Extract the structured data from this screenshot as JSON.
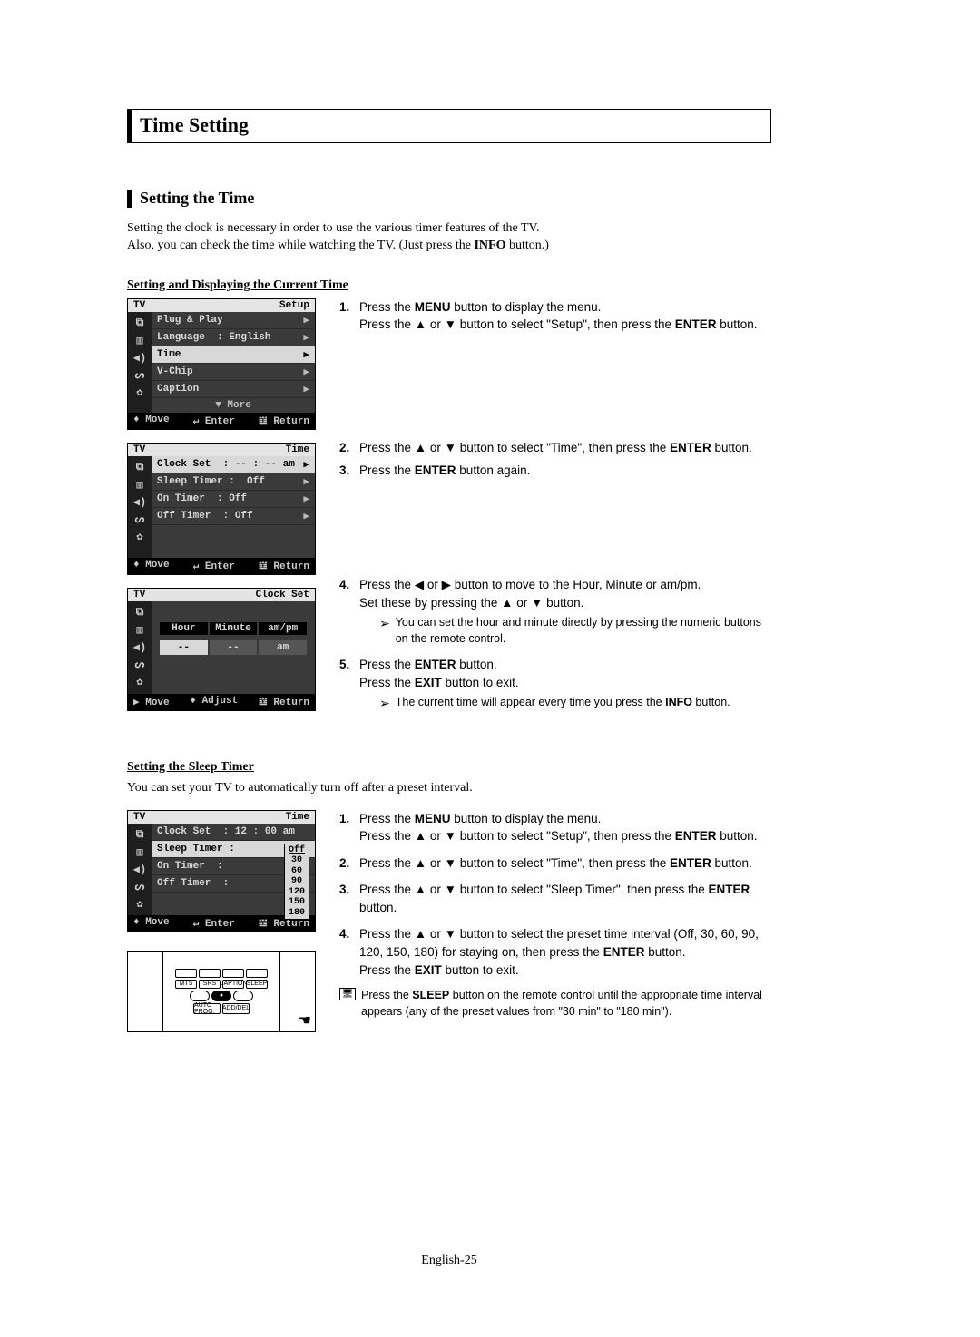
{
  "title": "Time Setting",
  "subtitle": "Setting the Time",
  "intro_line1": "Setting the clock is necessary in order to use the various timer features of the TV.",
  "intro_line2": "Also, you can check the time while watching the TV. (Just press the ",
  "intro_info": "INFO",
  "intro_line2b": " button.)",
  "sect1_label": "Setting and Displaying the Current Time",
  "osd": {
    "tv": "TV",
    "setup": "Setup",
    "time": "Time",
    "clockset": "Clock Set",
    "rows_setup": {
      "r1": "Plug & Play",
      "r2a": "Language",
      "r2b": ":  English",
      "r3": "Time",
      "r4": "V-Chip",
      "r5": "Caption",
      "more": "▼ More"
    },
    "rows_time": {
      "r1a": "Clock Set",
      "r1b": ": -- : -- am",
      "r2a": "Sleep Timer :",
      "r2b": "Off",
      "r3a": "On Timer",
      "r3b": ":  Off",
      "r4a": "Off Timer",
      "r4b": ":  Off"
    },
    "clock_cols": {
      "c1": "Hour",
      "c2": "Minute",
      "c3": "am/pm"
    },
    "clock_vals": {
      "v1": "--",
      "v2": "--",
      "v3": "am"
    },
    "foot": {
      "move_ud": "♦ Move",
      "move_r": "▶ Move",
      "enter": "↵ Enter",
      "adjust": "♦ Adjust",
      "ret": "𝍈 Return"
    }
  },
  "steps1": {
    "s1a": "Press the ",
    "s1b": "MENU",
    "s1c": " button to display the menu.",
    "s1d": "Press the ▲ or ▼ button to select \"Setup\", then press the ",
    "s1e": "ENTER",
    "s1f": " button.",
    "s2a": "Press the ▲ or ▼ button to select \"Time\", then press the ",
    "s2b": "ENTER",
    "s2c": " button.",
    "s3a": "Press the ",
    "s3b": "ENTER",
    "s3c": " button again.",
    "s4a": "Press the ◀ or ▶ button to move to the Hour, Minute or am/pm.",
    "s4b": "Set these by pressing the ▲ or ▼ button.",
    "n4": "You can set the hour and minute directly by pressing the numeric buttons on the remote control.",
    "s5a": "Press the ",
    "s5b": "ENTER",
    "s5c": " button.",
    "s5d": "Press the ",
    "s5e": "EXIT",
    "s5f": " button to exit.",
    "n5a": "The current time will appear every time you press the ",
    "n5b": "INFO",
    "n5c": " button."
  },
  "sect2_label": "Setting the Sleep Timer",
  "sleep_intro": "You can set your TV to automatically turn off after a preset interval.",
  "osd2": {
    "r1a": "Clock Set",
    "r1b": ": 12 : 00 am",
    "r2a": "Sleep Timer :",
    "r3a": "On Timer",
    "r3b": ":",
    "r4a": "Off Timer",
    "r4b": ":",
    "opts": {
      "o0": "Off",
      "o1": "30",
      "o2": "60",
      "o3": "90",
      "o4": "120",
      "o5": "150",
      "o6": "180"
    }
  },
  "steps2": {
    "s1a": "Press the ",
    "s1b": "MENU",
    "s1c": " button to display the menu.",
    "s1d": "Press the ▲ or ▼ button to select \"Setup\", then press the ",
    "s1e": "ENTER",
    "s1f": " button.",
    "s2a": "Press the ▲ or ▼ button to select \"Time\", then press the ",
    "s2b": "ENTER",
    "s2c": " button.",
    "s3a": "Press the ▲ or ▼ button to select \"Sleep Timer\", then press the ",
    "s3b": "ENTER",
    "s3c": "button.",
    "s4a": "Press the ▲ or ▼ button to select the preset time interval (Off, 30, 60, 90, 120, 150, 180) for staying on, then press the ",
    "s4b": "ENTER",
    "s4c": " button.",
    "s4d": "Press the ",
    "s4e": "EXIT",
    "s4f": " button to exit.",
    "sc1": "Press the ",
    "sc2": "SLEEP",
    "sc3": " button on the remote control until the appropriate time interval appears (any of the preset values from \"30 min\" to \"180 min\")."
  },
  "remote": {
    "b1": "MTS",
    "b2": "SRS",
    "b3": "CAPTION",
    "b4": "SLEEP",
    "b5": "AUTO PROG.",
    "b6": "ADD/DEL"
  },
  "page_num": "English-25"
}
